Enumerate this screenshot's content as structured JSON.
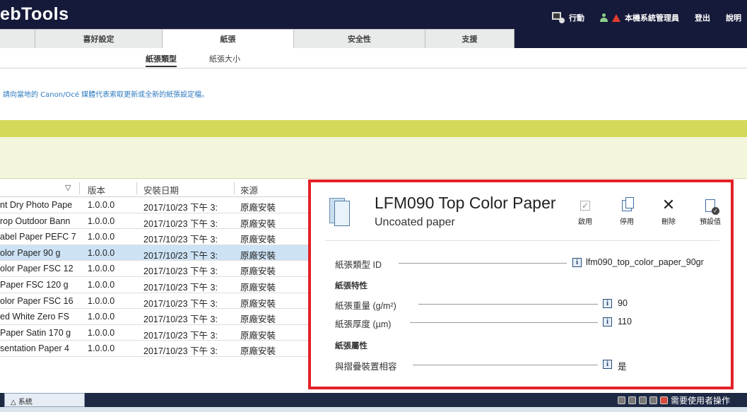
{
  "app": {
    "title": "ebTools"
  },
  "header": {
    "action_label": "行動",
    "user_label": "本機系統管理員",
    "logout_label": "登出",
    "help_label": "說明"
  },
  "tabs": [
    {
      "label": "喜好設定"
    },
    {
      "label": "紙張",
      "active": true
    },
    {
      "label": "安全性"
    },
    {
      "label": "支援"
    }
  ],
  "subtabs": [
    {
      "label": "紙張類型",
      "active": true
    },
    {
      "label": "紙張大小"
    }
  ],
  "notice": "請向當地的 Canon/Océ 媒體代表索取更新或全新的紙張設定檔。",
  "table": {
    "columns": [
      "▽",
      "版本",
      "安裝日期",
      "來源"
    ],
    "rows": [
      {
        "name": "nt Dry Photo Pape",
        "version": "1.0.0.0",
        "date": "2017/10/23 下午 3:",
        "source": "原廠安裝"
      },
      {
        "name": "rop Outdoor Bann",
        "version": "1.0.0.0",
        "date": "2017/10/23 下午 3:",
        "source": "原廠安裝"
      },
      {
        "name": "abel Paper PEFC 7",
        "version": "1.0.0.0",
        "date": "2017/10/23 下午 3:",
        "source": "原廠安裝"
      },
      {
        "name": "olor Paper 90 g",
        "version": "1.0.0.0",
        "date": "2017/10/23 下午 3:",
        "source": "原廠安裝",
        "selected": true
      },
      {
        "name": "olor Paper FSC 12",
        "version": "1.0.0.0",
        "date": "2017/10/23 下午 3:",
        "source": "原廠安裝"
      },
      {
        "name": "Paper FSC 120 g",
        "version": "1.0.0.0",
        "date": "2017/10/23 下午 3:",
        "source": "原廠安裝"
      },
      {
        "name": "olor Paper FSC 16",
        "version": "1.0.0.0",
        "date": "2017/10/23 下午 3:",
        "source": "原廠安裝"
      },
      {
        "name": "ed White Zero FS",
        "version": "1.0.0.0",
        "date": "2017/10/23 下午 3:",
        "source": "原廠安裝"
      },
      {
        "name": "Paper Satin 170 g",
        "version": "1.0.0.0",
        "date": "2017/10/23 下午 3:",
        "source": "原廠安裝"
      },
      {
        "name": "sentation Paper 4",
        "version": "1.0.0.0",
        "date": "2017/10/23 下午 3:",
        "source": "原廠安裝"
      }
    ]
  },
  "detail": {
    "title": "LFM090 Top Color Paper",
    "subtitle": "Uncoated paper",
    "actions": [
      {
        "label": "啟用",
        "icon": "check-icon"
      },
      {
        "label": "停用",
        "icon": "copy-icon"
      },
      {
        "label": "刪除",
        "icon": "close-icon"
      },
      {
        "label": "預設值",
        "icon": "default-icon"
      }
    ],
    "id_label": "紙張類型 ID",
    "id_value": "lfm090_top_color_paper_90gr",
    "section1": "紙張特性",
    "weight_label": "紙張重量 (g/m²)",
    "weight_value": "90",
    "thickness_label": "紙張厚度 (µm)",
    "thickness_value": "110",
    "section2": "紙張屬性",
    "compat_label": "與摺疊裝置相容",
    "compat_value": "是"
  },
  "statusbar": {
    "system_tab": "△ 系統",
    "user_action": "需要使用者操作"
  },
  "colors": {
    "header_bg": "#161a3a",
    "accent_band": "#d4d95a",
    "highlight_border": "#e32128",
    "selected_row": "#cde3f5"
  }
}
